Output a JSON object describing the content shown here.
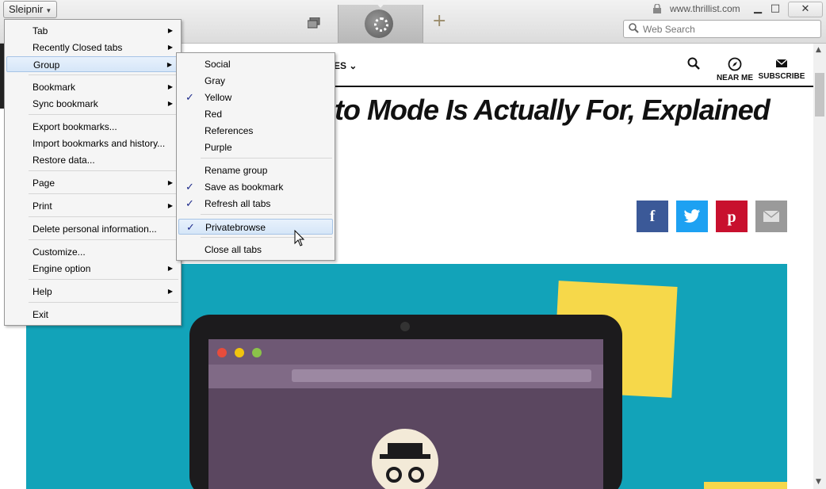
{
  "app": {
    "button_label": "Sleipnir"
  },
  "toolbar": {
    "url": "www.thrillist.com",
    "search_placeholder": "Web Search"
  },
  "site_nav": {
    "section_partial": "ES",
    "near_me": "NEAR ME",
    "subscribe": "SUBSCRIBE"
  },
  "article": {
    "headline_partial": "to Mode Is Actually For, Explained"
  },
  "share_icons": [
    "facebook-icon",
    "twitter-icon",
    "pinterest-icon",
    "mail-icon"
  ],
  "main_menu": {
    "items": [
      {
        "label": "Tab",
        "submenu": true
      },
      {
        "label": "Recently Closed tabs",
        "submenu": true
      },
      {
        "label": "Group",
        "submenu": true,
        "highlighted": true
      },
      {
        "label": "Bookmark",
        "submenu": true
      },
      {
        "label": "Sync bookmark",
        "submenu": true
      },
      {
        "label": "Export bookmarks...",
        "submenu": false
      },
      {
        "label": "Import bookmarks and history...",
        "submenu": false
      },
      {
        "label": "Restore data...",
        "submenu": false
      },
      {
        "label": "Page",
        "submenu": true
      },
      {
        "label": "Print",
        "submenu": true
      },
      {
        "label": "Delete personal information...",
        "submenu": false
      },
      {
        "label": "Customize...",
        "submenu": false
      },
      {
        "label": "Engine option",
        "submenu": true
      },
      {
        "label": "Help",
        "submenu": true
      },
      {
        "label": "Exit",
        "submenu": false
      }
    ]
  },
  "group_menu": {
    "items": [
      {
        "label": "Social",
        "checked": false
      },
      {
        "label": "Gray",
        "checked": false
      },
      {
        "label": "Yellow",
        "checked": true
      },
      {
        "label": "Red",
        "checked": false
      },
      {
        "label": "References",
        "checked": false
      },
      {
        "label": "Purple",
        "checked": false
      },
      {
        "label": "Rename group",
        "checked": false
      },
      {
        "label": "Save as bookmark",
        "checked": true
      },
      {
        "label": "Refresh all tabs",
        "checked": true
      },
      {
        "label": "Privatebrowse",
        "checked": true,
        "highlighted": true
      },
      {
        "label": "Close all tabs",
        "checked": false
      }
    ]
  },
  "colors": {
    "facebook": "#3b5998",
    "twitter": "#1da1f2",
    "pinterest": "#c8102e",
    "hero_bg": "#12a3b9",
    "check": "#1d2a8a"
  }
}
